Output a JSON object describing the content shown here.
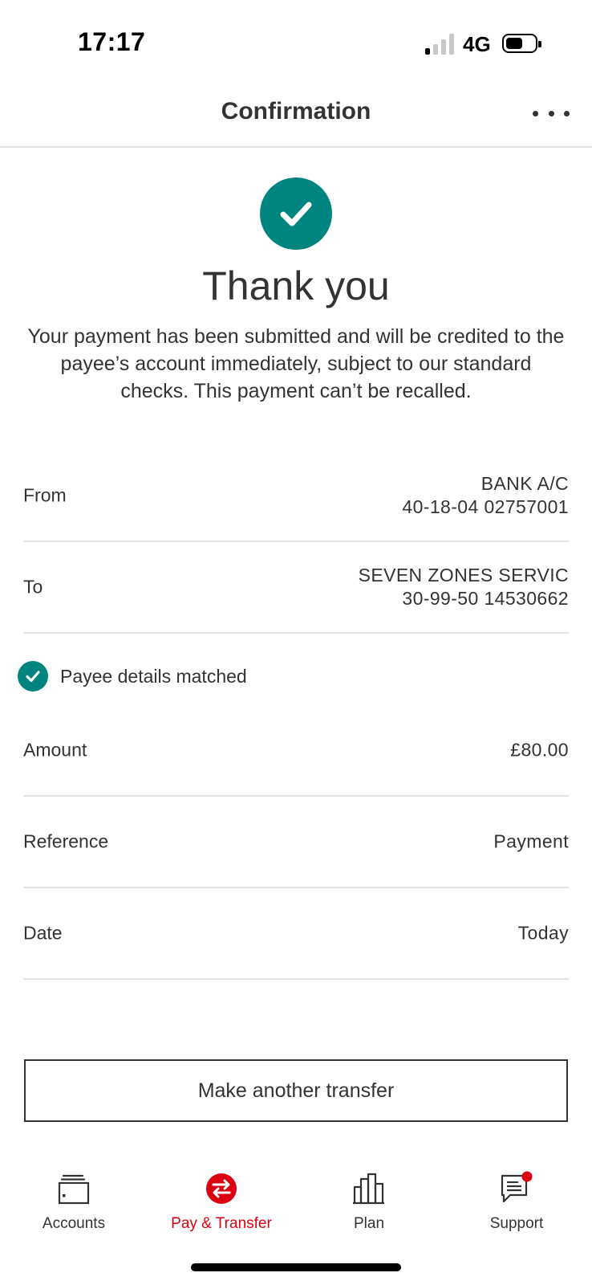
{
  "status_bar": {
    "time": "17:17",
    "network": "4G",
    "signal_bars_on": 1,
    "signal_bars_total": 4
  },
  "header": {
    "title": "Confirmation",
    "more_icon": "more-horizontal-icon"
  },
  "confirmation": {
    "icon": "check-circle-icon",
    "title": "Thank you",
    "message": "Your payment has been submitted and will be credited to the payee’s account immediately, subject to our standard checks. This payment can’t be recalled."
  },
  "details": {
    "from": {
      "label": "From",
      "name": "BANK A/C",
      "account": "40-18-04 02757001"
    },
    "to": {
      "label": "To",
      "name": "SEVEN ZONES SERVIC",
      "account": "30-99-50 14530662"
    },
    "payee_match": {
      "icon": "check-circle-icon",
      "text": "Payee details matched"
    },
    "amount": {
      "label": "Amount",
      "value": "£80.00"
    },
    "reference": {
      "label": "Reference",
      "value": "Payment"
    },
    "date": {
      "label": "Date",
      "value": "Today"
    }
  },
  "actions": {
    "make_another_transfer": "Make another transfer"
  },
  "bottom_nav": {
    "items": [
      {
        "label": "Accounts",
        "icon": "wallet-icon",
        "active": false
      },
      {
        "label": "Pay & Transfer",
        "icon": "transfer-arrows-icon",
        "active": true
      },
      {
        "label": "Plan",
        "icon": "bar-chart-icon",
        "active": false
      },
      {
        "label": "Support",
        "icon": "chat-notification-icon",
        "active": false,
        "has_notification": true
      }
    ]
  },
  "colors": {
    "accent_teal": "#00847f",
    "brand_red": "#db0011",
    "text": "#333333",
    "divider": "#e3e3e3"
  }
}
